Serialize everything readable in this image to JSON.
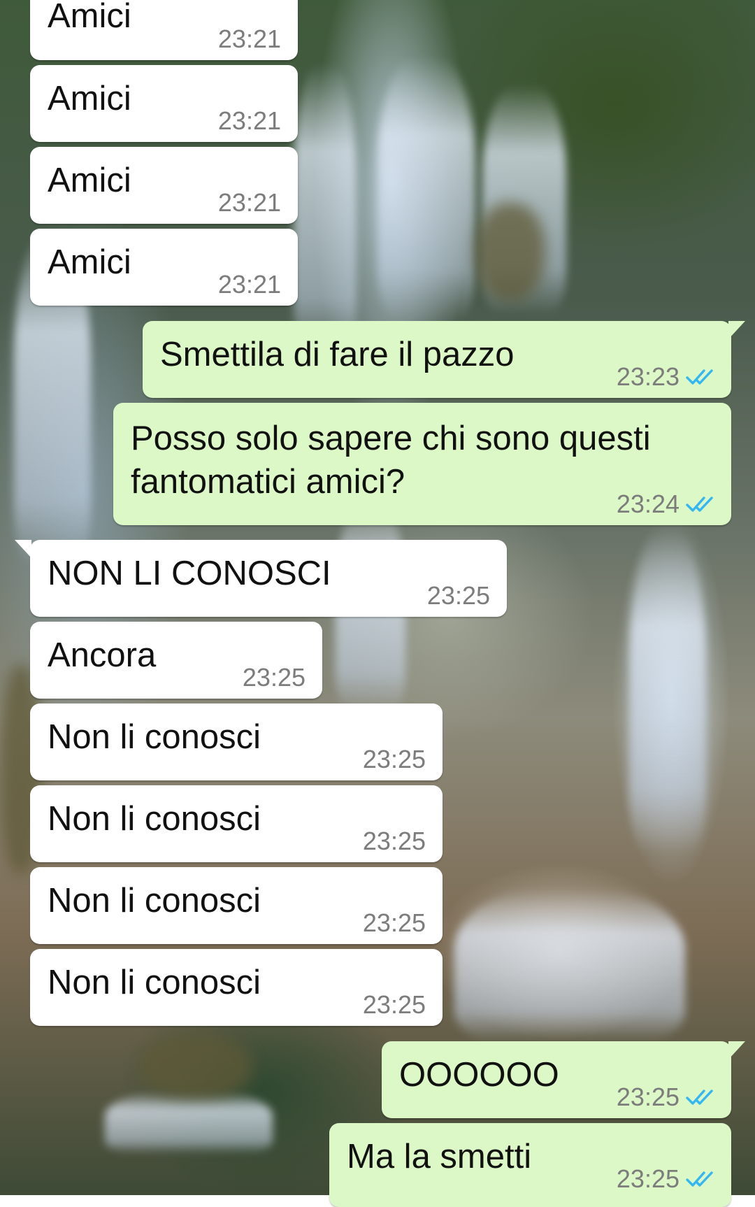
{
  "chat": {
    "messages": [
      {
        "side": "in",
        "text": "Amici",
        "time": "23:21"
      },
      {
        "side": "in",
        "text": "Amici",
        "time": "23:21"
      },
      {
        "side": "in",
        "text": "Amici",
        "time": "23:21"
      },
      {
        "side": "in",
        "text": "Amici",
        "time": "23:21"
      },
      {
        "side": "out",
        "text": "Smettila di fare il pazzo",
        "time": "23:23",
        "status": "read"
      },
      {
        "side": "out",
        "text": "Posso solo sapere chi sono questi fantomatici amici?",
        "time": "23:24",
        "status": "read"
      },
      {
        "side": "in",
        "text": "NON LI CONOSCI",
        "time": "23:25"
      },
      {
        "side": "in",
        "text": "Ancora",
        "time": "23:25"
      },
      {
        "side": "in",
        "text": "Non li conosci",
        "time": "23:25"
      },
      {
        "side": "in",
        "text": "Non li conosci",
        "time": "23:25"
      },
      {
        "side": "in",
        "text": "Non li conosci",
        "time": "23:25"
      },
      {
        "side": "in",
        "text": "Non li conosci",
        "time": "23:25"
      },
      {
        "side": "out",
        "text": "OOOOOO",
        "time": "23:25",
        "status": "read"
      },
      {
        "side": "out",
        "text": "Ma la smetti",
        "time": "23:25",
        "status": "read"
      }
    ]
  },
  "colors": {
    "incoming_bubble": "#ffffff",
    "outgoing_bubble": "#dcf8c6",
    "timestamp": "#7c7c7c",
    "read_ticks": "#34b7f1"
  },
  "icons": {
    "read_status": "double-check-icon",
    "wallpaper": "waterfall-wallpaper"
  }
}
